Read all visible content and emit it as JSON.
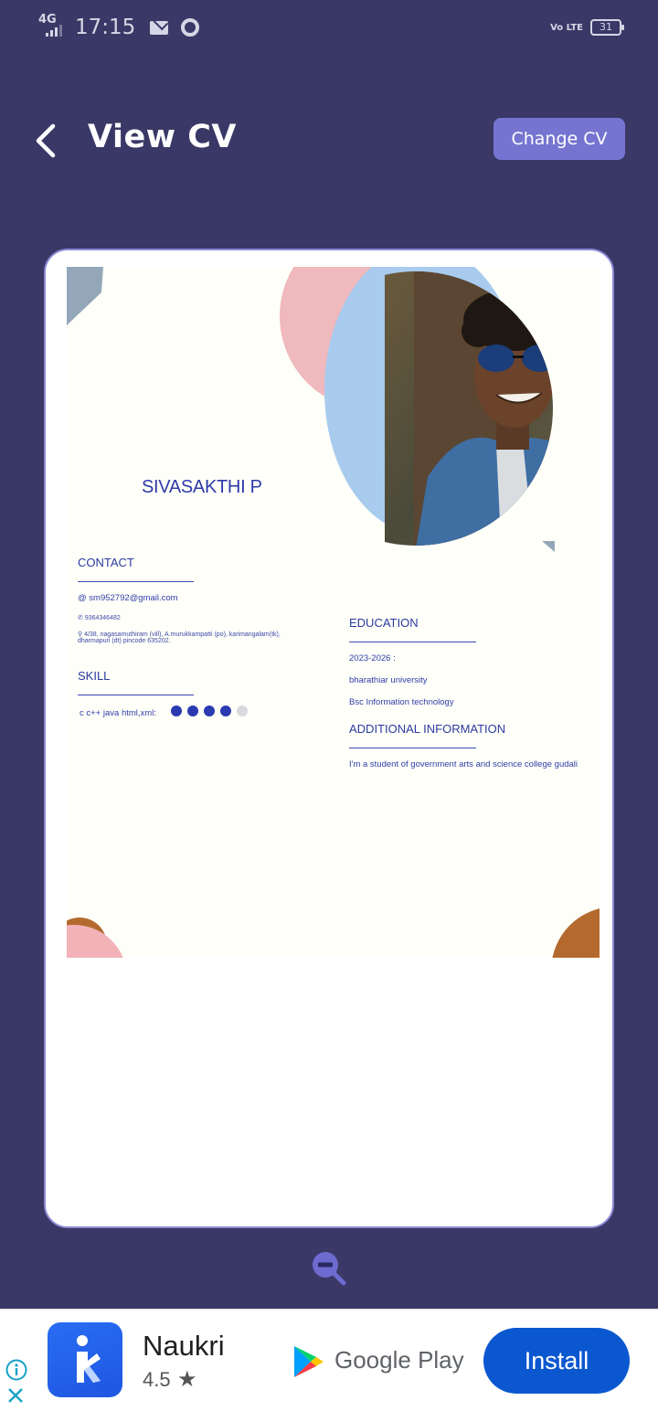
{
  "status_bar": {
    "network": "4G",
    "time": "17:15",
    "volte": "Vo LTE",
    "battery": "31"
  },
  "header": {
    "title": "View CV",
    "change_button": "Change CV"
  },
  "cv": {
    "name": "SIVASAKTHI P",
    "contact_heading": "CONTACT",
    "email": "sm952792@gmail.com",
    "phone": "9364346482",
    "address_line1": "4/38, nagasamuthiram (vill), A.murukkampatti (po), karimangalam(tk),",
    "address_line2": "dharmapuri (dt) pincode 635202.",
    "skill_heading": "SKILL",
    "skill_text": "c c++ java html,xml:",
    "skill_level": 4,
    "skill_max": 5,
    "education_heading": "EDUCATION",
    "edu_year": "2023-2026 :",
    "edu_institution": "bharathiar university",
    "edu_degree": "Bsc Information technology",
    "additional_heading": "ADDITIONAL INFORMATION",
    "additional_text": "I'm a student of government arts and science college gudali"
  },
  "ad": {
    "app_name": "Naukri",
    "rating": "4.5",
    "store": "Google Play",
    "install_label": "Install"
  }
}
